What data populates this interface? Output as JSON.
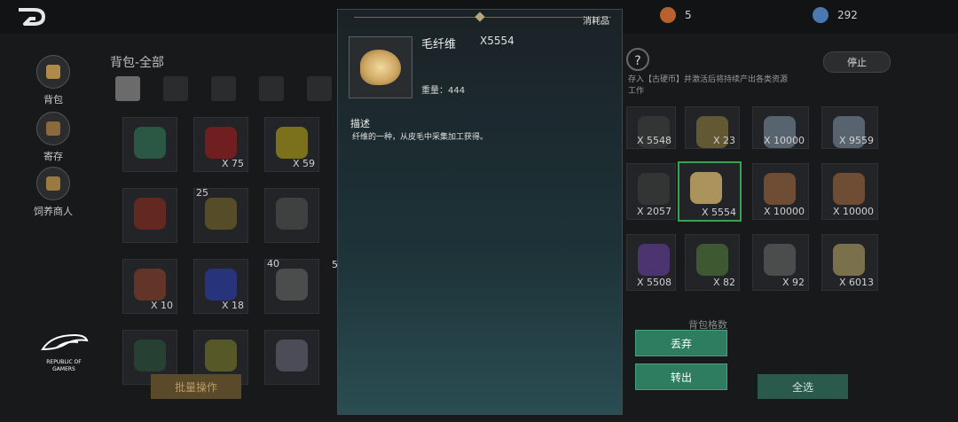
{
  "topbar": {
    "currency_1": "5",
    "currency_2": "292"
  },
  "left_nav": {
    "items": [
      {
        "label": "背包"
      },
      {
        "label": "寄存"
      },
      {
        "label": "饲养商人"
      }
    ]
  },
  "bag": {
    "title": "背包-全部"
  },
  "left_grid": {
    "counts": [
      "",
      "X 75",
      "X 59",
      "",
      "X 10",
      "X 18",
      ""
    ],
    "levels": [
      "25",
      "40",
      "5"
    ]
  },
  "right_panel": {
    "stop_label": "停止",
    "info_line1": "存入【古硬币】并激活后将持续产出各类资源",
    "info_line2": "工作",
    "storage_label": "背包格数",
    "grid_counts": [
      "X 5548",
      "X 23",
      "X 10000",
      "X 9559",
      "X 2057",
      "X 5554",
      "X 10000",
      "X 10000",
      "X 5508",
      "X 82",
      "X 92",
      "X 6013"
    ]
  },
  "modal": {
    "category_badge": "消耗品",
    "item_name": "毛纤维",
    "item_qty": "X5554",
    "weight": "重量：444",
    "desc_title": "描述",
    "desc_text": "纤维的一种，从皮毛中采集加工获得。"
  },
  "buttons": {
    "batch": "批量操作",
    "discard": "丢弃",
    "transfer": "转出",
    "select_all": "全选"
  },
  "logo": {
    "line1": "REPUBLIC OF",
    "line2": "GAMERS"
  },
  "colors": {
    "accent_green": "#2f7d60",
    "selection_border": "#3aa255",
    "gold": "#b6a67a"
  }
}
